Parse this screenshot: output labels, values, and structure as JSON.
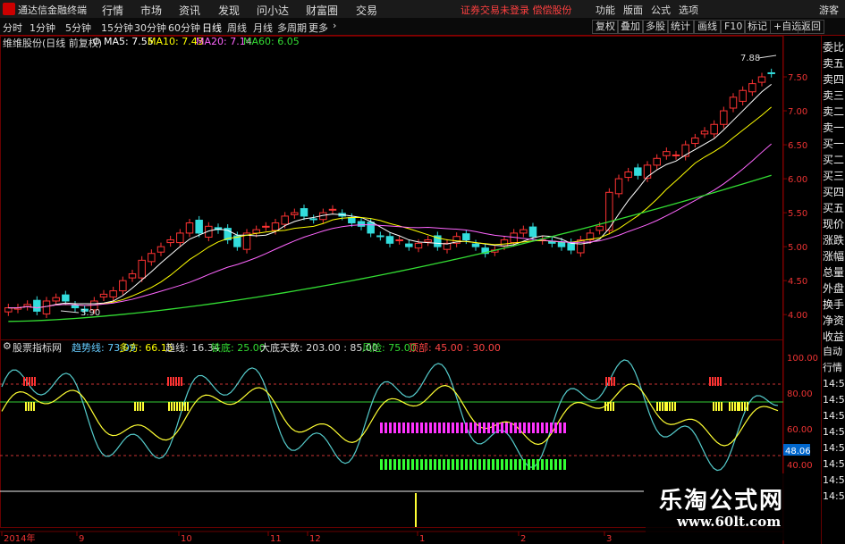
{
  "menubar": {
    "app_name": "通达信金融终端",
    "items": [
      "行情",
      "市场",
      "资讯",
      "发现",
      "问小达",
      "财富圈",
      "交易"
    ],
    "login_notice": "证券交易未登录 偿偿股份",
    "right_items": [
      "功能",
      "版面",
      "公式",
      "选项"
    ],
    "guest": "游客"
  },
  "periodbar": {
    "periods": [
      "分时",
      "1分钟",
      "5分钟",
      "15分钟",
      "30分钟",
      "60分钟",
      "日线",
      "周线",
      "月线",
      "多周期",
      "更多"
    ],
    "active": "日线",
    "right_tools": [
      "复权",
      "叠加",
      "多股",
      "统计",
      "画线",
      "F10",
      "标记",
      "+自选",
      "返回"
    ]
  },
  "price_header": {
    "stock": "维维股份(日线 前复权)",
    "ma5": "MA5: 7.55",
    "ma10": "MA10: 7.43",
    "ma20": "MA20: 7.14",
    "ma60": "MA60: 6.05",
    "colors": {
      "ma5": "#ffffff",
      "ma10": "#ffff00",
      "ma20": "#ff66ff",
      "ma60": "#33dd33"
    }
  },
  "price_axis": [
    "7.50",
    "7.00",
    "6.50",
    "6.00",
    "5.50",
    "5.00",
    "4.50",
    "4.00"
  ],
  "price_annotations": {
    "high": "7.88",
    "low": "3.90"
  },
  "indicator_header": {
    "name": "股票指标网",
    "trend": "趋势线: 73.09",
    "bull": "多方: 66.15",
    "trendline": "趋线: 16.34",
    "bottom": "铁底: 25.00",
    "days": "大底天数: 203.00 : 85.00",
    "risk": "风险: 75.00",
    "top": "顶部: 45.00 : 30.00"
  },
  "indicator_axis": [
    "100.00",
    "80.00",
    "60.00",
    "40.00"
  ],
  "indicator_current": "48.06",
  "date_axis": [
    "2014年",
    "9",
    "10",
    "11",
    "12",
    "1",
    "2",
    "3"
  ],
  "right_panel": [
    "委比",
    "卖五",
    "卖四",
    "卖三",
    "卖二",
    "卖一",
    "买一",
    "买二",
    "买三",
    "买四",
    "买五",
    "现价",
    "涨跌",
    "涨幅",
    "总量",
    "外盘",
    "换手",
    "净资",
    "收益"
  ],
  "right_panel_lower": [
    "自动",
    "行情",
    "14:5",
    "14:5",
    "14:5",
    "14:5",
    "14:5",
    "14:5",
    "14:5",
    "14:5"
  ],
  "watermark": {
    "cn": "乐淘公式网",
    "url": "www.60lt.com"
  },
  "chart_data": {
    "type": "candlestick",
    "title": "维维股份(日线 前复权)",
    "ylim": [
      3.7,
      8.0
    ],
    "close_series": [
      4.1,
      4.1,
      4.15,
      4.05,
      4.2,
      4.25,
      4.2,
      4.1,
      4.05,
      4.2,
      4.3,
      4.35,
      4.5,
      4.6,
      4.8,
      4.9,
      5.0,
      5.1,
      5.2,
      5.35,
      5.2,
      5.3,
      5.25,
      5.1,
      5.0,
      5.2,
      5.25,
      5.3,
      5.35,
      5.45,
      5.5,
      5.45,
      5.4,
      5.5,
      5.55,
      5.45,
      5.35,
      5.3,
      5.2,
      5.15,
      5.05,
      5.1,
      5.0,
      5.05,
      5.1,
      5.0,
      5.05,
      5.15,
      5.1,
      5.0,
      4.9,
      4.95,
      5.1,
      5.2,
      5.25,
      5.15,
      5.1,
      5.05,
      5.0,
      4.95,
      5.1,
      5.2,
      5.3,
      5.8,
      6.0,
      6.1,
      6.05,
      6.2,
      6.3,
      6.4,
      6.35,
      6.5,
      6.6,
      6.7,
      6.8,
      7.0,
      7.2,
      7.3,
      7.4,
      7.5,
      7.55
    ],
    "ma60_endpoints": [
      3.9,
      6.05
    ]
  }
}
